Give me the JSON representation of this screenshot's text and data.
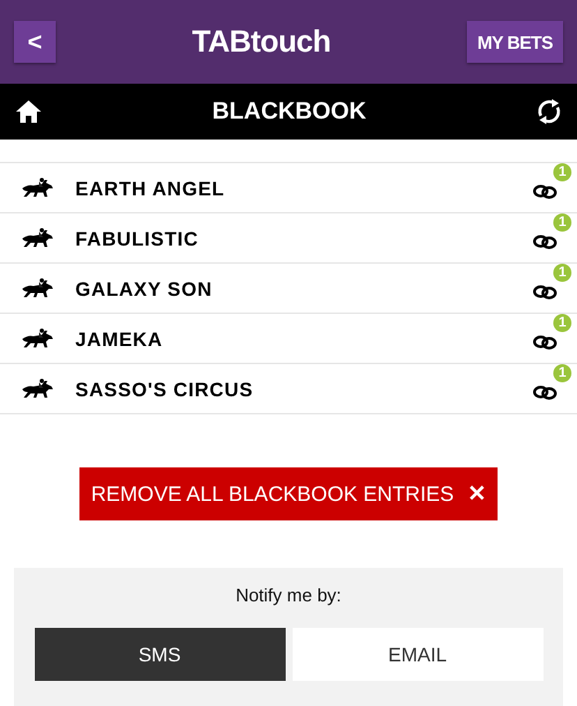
{
  "header": {
    "back_label": "<",
    "logo": "TABtouch",
    "my_bets": "MY BETS"
  },
  "title_bar": {
    "title": "BLACKBOOK"
  },
  "entries": [
    {
      "name": "EARTH ANGEL",
      "count": "1"
    },
    {
      "name": "FABULISTIC",
      "count": "1"
    },
    {
      "name": "GALAXY SON",
      "count": "1"
    },
    {
      "name": "JAMEKA",
      "count": "1"
    },
    {
      "name": "SASSO'S CIRCUS",
      "count": "1"
    }
  ],
  "remove_button": {
    "label": "REMOVE ALL BLACKBOOK ENTRIES",
    "icon": "✕"
  },
  "notify": {
    "label": "Notify me by:",
    "options": [
      {
        "label": "SMS",
        "selected": true
      },
      {
        "label": "EMAIL",
        "selected": false
      }
    ]
  }
}
